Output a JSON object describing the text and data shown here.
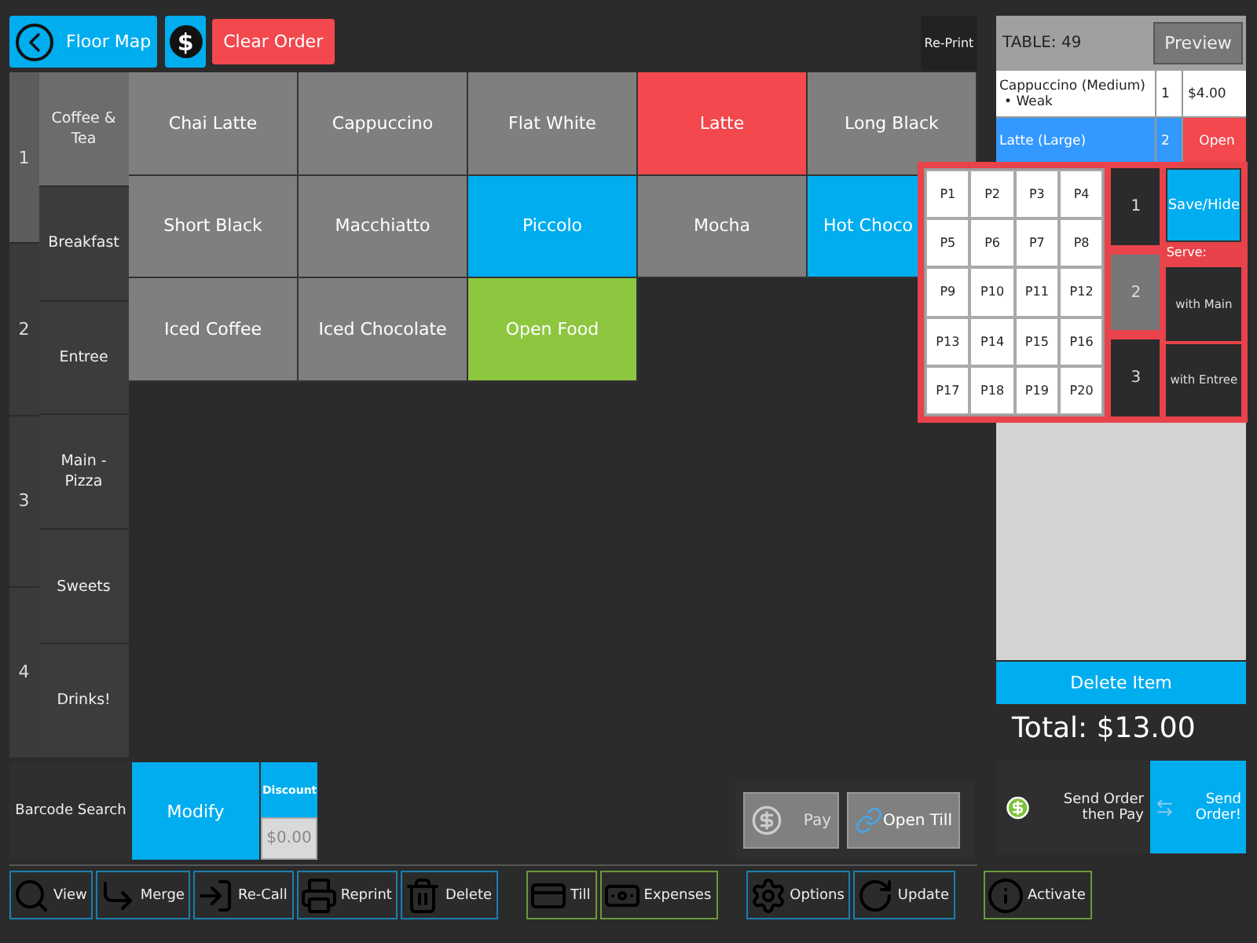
{
  "top_bar": {
    "floor_map": "Floor Map",
    "cash_symbol": "$",
    "clear_order": "Clear Order",
    "reprint": "Re-Print"
  },
  "pages": [
    {
      "label": "1",
      "selected": true
    },
    {
      "label": "2",
      "selected": false
    },
    {
      "label": "3",
      "selected": false
    },
    {
      "label": "4",
      "selected": false
    }
  ],
  "categories": [
    {
      "label": "Coffee & Tea",
      "selected": true
    },
    {
      "label": "Breakfast",
      "selected": false
    },
    {
      "label": "Entree",
      "selected": false
    },
    {
      "label": "Main - Pizza",
      "selected": false
    },
    {
      "label": "Sweets",
      "selected": false
    },
    {
      "label": "Drinks!",
      "selected": false
    }
  ],
  "products": [
    {
      "label": "Chai Latte",
      "color": "#7f7f7f"
    },
    {
      "label": "Cappuccino",
      "color": "#7f7f7f"
    },
    {
      "label": "Flat White",
      "color": "#7f7f7f"
    },
    {
      "label": "Latte",
      "color": "#f2484e"
    },
    {
      "label": "Long Black",
      "color": "#7f7f7f"
    },
    {
      "label": "Short Black",
      "color": "#7f7f7f"
    },
    {
      "label": "Macchiatto",
      "color": "#7f7f7f"
    },
    {
      "label": "Piccolo",
      "color": "#00adef"
    },
    {
      "label": "Mocha",
      "color": "#7f7f7f"
    },
    {
      "label": "Hot Choco",
      "color": "#00adef"
    },
    {
      "label": "Iced Coffee",
      "color": "#7f7f7f"
    },
    {
      "label": "Iced Chocolate",
      "color": "#7f7f7f"
    },
    {
      "label": "Open Food",
      "color": "#8dc63f"
    }
  ],
  "order": {
    "table": "TABLE: 49",
    "preview": "Preview",
    "lines": [
      {
        "name": "Cappuccino (Medium)",
        "modifiers": [
          "• Weak"
        ],
        "qty": "1",
        "price": "$4.00",
        "kind": "priced",
        "selected": false
      },
      {
        "name": "Latte (Large)",
        "qty": "2",
        "price": "Open",
        "kind": "open",
        "selected": true
      }
    ],
    "delete": "Delete Item",
    "total": "Total: $13.00",
    "send_pay": "Send Order then Pay",
    "send": "Send Order!"
  },
  "popup": {
    "seats": [
      "P1",
      "P2",
      "P3",
      "P4",
      "P5",
      "P6",
      "P7",
      "P8",
      "P9",
      "P10",
      "P11",
      "P12",
      "P13",
      "P14",
      "P15",
      "P16",
      "P17",
      "P18",
      "P19",
      "P20"
    ],
    "courses": [
      {
        "label": "1",
        "selected": false
      },
      {
        "label": "2",
        "selected": true
      },
      {
        "label": "3",
        "selected": false
      }
    ],
    "save": "Save/Hide",
    "serve_label": "Serve:",
    "serve": [
      "with Main",
      "with Entree"
    ]
  },
  "bottom": {
    "barcode": "Barcode Search",
    "modify": "Modify",
    "discount": "Discount",
    "discount_value": "$0.00",
    "pay": "Pay",
    "open_till": "Open Till"
  },
  "toolbar": [
    {
      "color": "#1a7fb0",
      "items": [
        "View",
        "Merge",
        "Re-Call",
        "Reprint",
        "Delete"
      ]
    },
    {
      "color": "#6a9a3a",
      "items": [
        "Till",
        "Expenses"
      ]
    },
    {
      "color": "#1a7fb0",
      "items": [
        "Options",
        "Update"
      ]
    },
    {
      "color": "#6a9a3a",
      "items": [
        "Activate"
      ]
    }
  ]
}
